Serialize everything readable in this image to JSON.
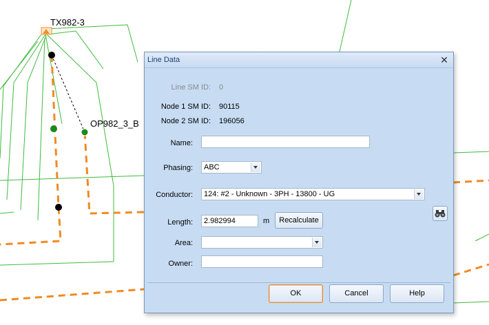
{
  "map": {
    "transformer_label": "TX982-3",
    "point_label": "OP982_3_B",
    "colors": {
      "line_green": "#3dbb3d",
      "dashed_orange": "#f08a24",
      "node_green": "#1a8a1a",
      "node_black": "#000000",
      "transformer_orange": "#f28c28"
    }
  },
  "dialog": {
    "title": "Line Data",
    "line_sm_id": {
      "label": "Line SM ID:",
      "value": "0"
    },
    "node1": {
      "label": "Node 1 SM ID:",
      "value": "90115"
    },
    "node2": {
      "label": "Node 2 SM ID:",
      "value": "196056"
    },
    "name": {
      "label": "Name:",
      "value": ""
    },
    "phasing": {
      "label": "Phasing:",
      "value": "ABC"
    },
    "conductor": {
      "label": "Conductor:",
      "value": "124: #2 - Unknown - 3PH - 13800 - UG"
    },
    "length": {
      "label": "Length:",
      "value": "2.982994",
      "unit": "m",
      "recalc_label": "Recalculate"
    },
    "area": {
      "label": "Area:",
      "value": ""
    },
    "owner": {
      "label": "Owner:",
      "value": ""
    },
    "buttons": {
      "ok": "OK",
      "cancel": "Cancel",
      "help": "Help"
    }
  }
}
